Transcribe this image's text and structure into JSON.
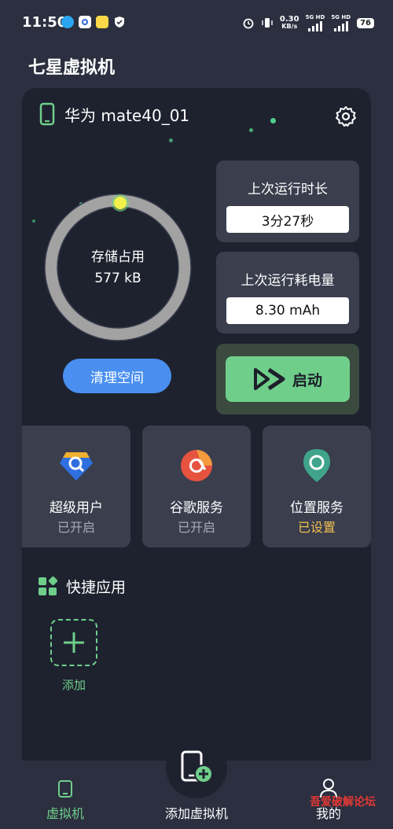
{
  "status_bar": {
    "time": "11:50",
    "net_speed_value": "0.30",
    "net_speed_unit": "KB/s",
    "sim1": "5G HD",
    "sim2": "5G HD",
    "battery": "76"
  },
  "app": {
    "title": "七星虚拟机"
  },
  "device": {
    "name": "华为 mate40_01",
    "icon": "phone-icon",
    "settings_icon": "gear-icon"
  },
  "storage": {
    "label": "存储占用",
    "value": "577 kB"
  },
  "clean_button": "清理空间",
  "stats": {
    "last_runtime_label": "上次运行时长",
    "last_runtime_value": "3分27秒",
    "last_power_label": "上次运行耗电量",
    "last_power_value": "8.30 mAh"
  },
  "start_button": "启动",
  "features": [
    {
      "title": "超级用户",
      "status": "已开启",
      "icon": "super-user-icon"
    },
    {
      "title": "谷歌服务",
      "status": "已开启",
      "icon": "google-service-icon"
    },
    {
      "title": "位置服务",
      "status": "已设置",
      "icon": "location-service-icon"
    }
  ],
  "quick_apps": {
    "title": "快捷应用",
    "add_label": "添加"
  },
  "bottom_nav": {
    "items": [
      {
        "label": "虚拟机",
        "icon": "virtual-machine-icon"
      },
      {
        "label": "添加虚拟机",
        "icon": "add-vm-icon"
      },
      {
        "label": "我的",
        "icon": "profile-icon"
      }
    ]
  },
  "watermark": "吾爱破解论坛",
  "colors": {
    "background": "#2b2f3f",
    "card": "#1e222f",
    "accent_green": "#6fcf8a",
    "accent_blue": "#4a8ff0",
    "warning": "#f2c14e"
  }
}
